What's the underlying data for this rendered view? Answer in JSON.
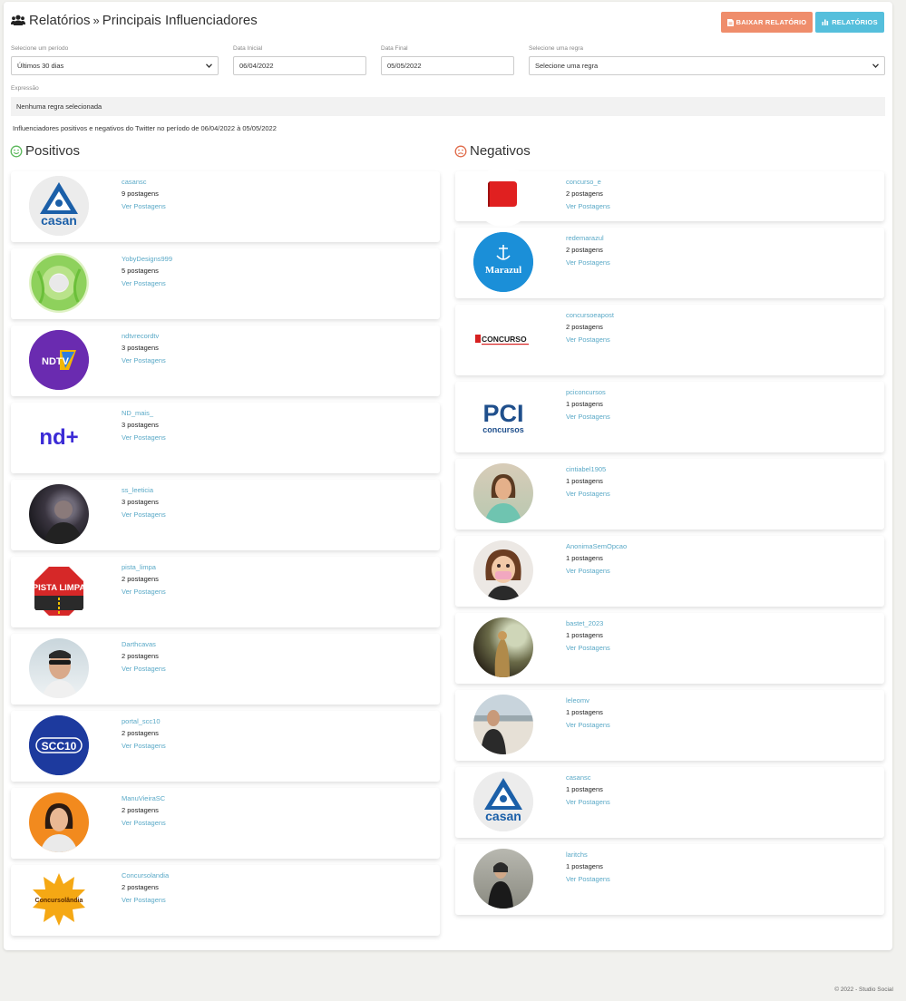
{
  "header": {
    "title_part1": "Relatórios",
    "title_part2": "Principais Influenciadores",
    "download_button": "BAIXAR RELATÓRIO",
    "reports_button": "RELATÓRIOS"
  },
  "filters": {
    "period_label": "Selecione um período",
    "period_value": "Últimos 30 dias",
    "start_label": "Data Inicial",
    "start_value": "06/04/2022",
    "end_label": "Data Final",
    "end_value": "05/05/2022",
    "rule_label": "Selecione uma regra",
    "rule_value": "Selecione uma regra"
  },
  "expression": {
    "label": "Expressão",
    "value": "Nenhuma regra selecionada"
  },
  "description": "Influenciadores positivos e negativos do Twitter no período de 06/04/2022 à 05/05/2022",
  "positive": {
    "heading": "Positivos",
    "items": [
      {
        "username": "casansc",
        "posts": "9 postagens",
        "link": "Ver Postagens",
        "avatar": "casan-logo"
      },
      {
        "username": "YobyDesigns999",
        "posts": "5 postagens",
        "link": "Ver Postagens",
        "avatar": "leaf-photo"
      },
      {
        "username": "ndtvrecordtv",
        "posts": "3 postagens",
        "link": "Ver Postagens",
        "avatar": "ndtv-logo"
      },
      {
        "username": "ND_mais_",
        "posts": "3 postagens",
        "link": "Ver Postagens",
        "avatar": "nd-plus-logo"
      },
      {
        "username": "ss_leeticia",
        "posts": "3 postagens",
        "link": "Ver Postagens",
        "avatar": "person-photo"
      },
      {
        "username": "pista_limpa",
        "posts": "2 postagens",
        "link": "Ver Postagens",
        "avatar": "pista-limpa-logo"
      },
      {
        "username": "Darthcavas",
        "posts": "2 postagens",
        "link": "Ver Postagens",
        "avatar": "person-photo"
      },
      {
        "username": "portal_scc10",
        "posts": "2 postagens",
        "link": "Ver Postagens",
        "avatar": "scc10-logo"
      },
      {
        "username": "ManuVieiraSC",
        "posts": "2 postagens",
        "link": "Ver Postagens",
        "avatar": "person-photo"
      },
      {
        "username": "Concursolandia",
        "posts": "2 postagens",
        "link": "Ver Postagens",
        "avatar": "concursolandia-logo"
      }
    ]
  },
  "negative": {
    "heading": "Negativos",
    "items": [
      {
        "username": "concurso_e",
        "posts": "2 postagens",
        "link": "Ver Postagens",
        "avatar": "book-logo"
      },
      {
        "username": "redemarazul",
        "posts": "2 postagens",
        "link": "Ver Postagens",
        "avatar": "marazul-logo"
      },
      {
        "username": "concursoeapost",
        "posts": "2 postagens",
        "link": "Ver Postagens",
        "avatar": "concurso-logo"
      },
      {
        "username": "pciconcursos",
        "posts": "1 postagens",
        "link": "Ver Postagens",
        "avatar": "pci-logo"
      },
      {
        "username": "cintiabel1905",
        "posts": "1 postagens",
        "link": "Ver Postagens",
        "avatar": "person-photo"
      },
      {
        "username": "AnonimaSemOpcao",
        "posts": "1 postagens",
        "link": "Ver Postagens",
        "avatar": "cartoon-avatar"
      },
      {
        "username": "bastet_2023",
        "posts": "1 postagens",
        "link": "Ver Postagens",
        "avatar": "art-photo"
      },
      {
        "username": "leleomv",
        "posts": "1 postagens",
        "link": "Ver Postagens",
        "avatar": "person-photo"
      },
      {
        "username": "casansc",
        "posts": "1 postagens",
        "link": "Ver Postagens",
        "avatar": "casan-logo"
      },
      {
        "username": "laritchs",
        "posts": "1 postagens",
        "link": "Ver Postagens",
        "avatar": "person-photo"
      }
    ]
  },
  "logo_text": {
    "casan": "casan",
    "ndtv": "NDTV",
    "nd_plus": "nd+",
    "pista_limpa": "PISTA LIMPA",
    "scc10": "SCC10",
    "concursolandia": "Concursolândia",
    "marazul": "Marazul",
    "concurso": "CONCURSO",
    "pci": "PCI",
    "pci_sub": "concursos"
  },
  "footer": "© 2022 - Studio Social",
  "colors": {
    "accent_orange": "#ef8d6b",
    "accent_blue": "#55bfdc",
    "positive_icon": "#5cb85c",
    "negative_icon": "#e06b4a",
    "link": "#5aa9c7"
  }
}
